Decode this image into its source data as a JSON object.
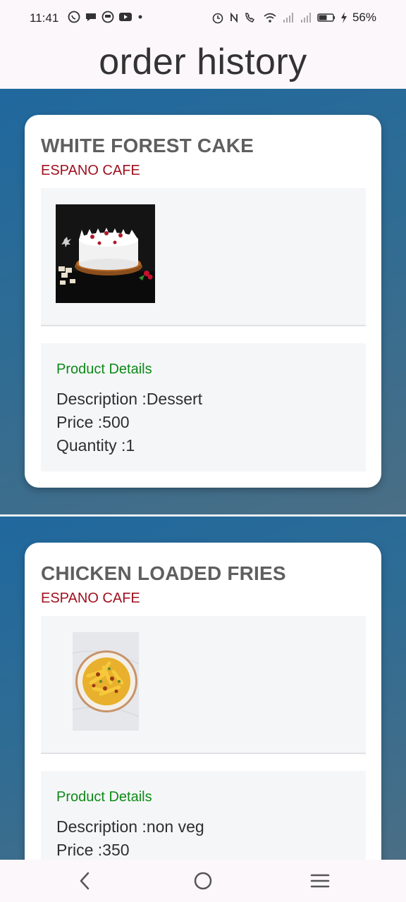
{
  "status_bar": {
    "time": "11:41",
    "battery": "56%",
    "left_icons": [
      "whatsapp-icon",
      "chat-bubble-icon",
      "messenger-icon",
      "youtube-icon",
      "dot-icon"
    ],
    "right_icons": [
      "alarm-icon",
      "nfc-icon",
      "wifi-call-icon",
      "wifi-icon",
      "signal-icon",
      "signal-icon",
      "battery-icon",
      "charging-icon"
    ]
  },
  "header": {
    "title": "order history"
  },
  "orders": [
    {
      "product_name": "WHITE FOREST CAKE",
      "restaurant": "ESPANO CAFE",
      "image": "white-forest-cake-image",
      "details_title": "Product Details",
      "description": "Description :Dessert",
      "price": "Price :500",
      "quantity": "Quantity :1"
    },
    {
      "product_name": "CHICKEN LOADED FRIES",
      "restaurant": "ESPANO CAFE",
      "image": "chicken-loaded-fries-image",
      "details_title": "Product Details",
      "description": "Description :non veg",
      "price": "Price :350"
    }
  ],
  "nav_bar": {
    "icons": [
      "back-icon",
      "home-icon",
      "recents-icon"
    ]
  },
  "colors": {
    "accent_gradient_start": "#20689e",
    "accent_gradient_end": "#4a6e85",
    "restaurant_text": "#a0101e",
    "details_title": "#0c8a16"
  }
}
